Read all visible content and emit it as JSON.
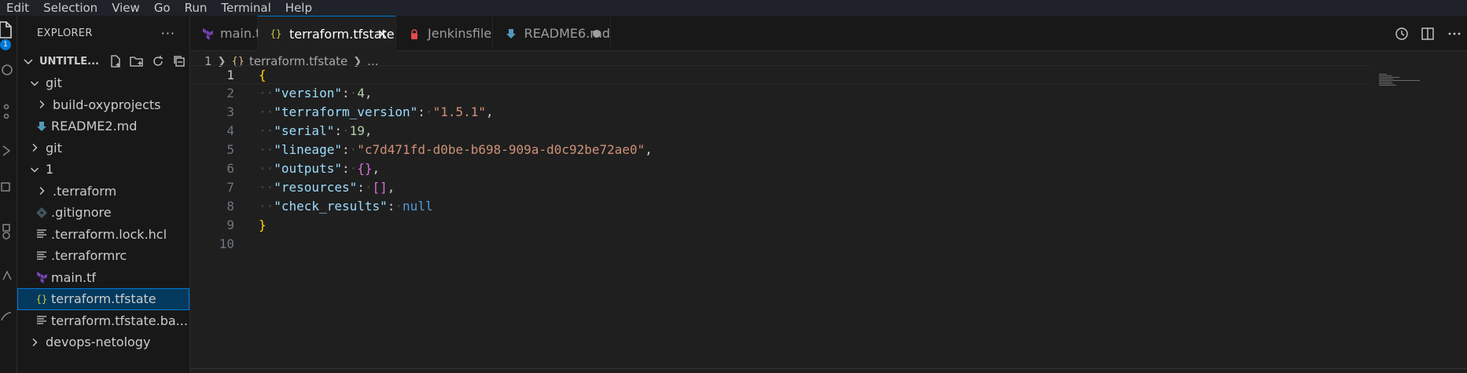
{
  "menu": [
    "Edit",
    "Selection",
    "View",
    "Go",
    "Run",
    "Terminal",
    "Help"
  ],
  "activity": {
    "scm_badge": "1"
  },
  "explorer": {
    "title": "EXPLORER",
    "more": "···",
    "folder": "UNTITLE...",
    "tree": [
      {
        "label": "git",
        "twisty": "down",
        "indent": 0,
        "icon": ""
      },
      {
        "label": "build-oxyprojects",
        "twisty": "right",
        "indent": 1,
        "icon": ""
      },
      {
        "label": "README2.md",
        "twisty": "",
        "indent": 1,
        "icon": "markdown-icon"
      },
      {
        "label": "git",
        "twisty": "right",
        "indent": 0,
        "icon": ""
      },
      {
        "label": "1",
        "twisty": "down",
        "indent": 0,
        "icon": ""
      },
      {
        "label": ".terraform",
        "twisty": "right",
        "indent": 1,
        "icon": ""
      },
      {
        "label": ".gitignore",
        "twisty": "",
        "indent": 1,
        "icon": "git-icon"
      },
      {
        "label": ".terraform.lock.hcl",
        "twisty": "",
        "indent": 1,
        "icon": "lines-icon"
      },
      {
        "label": ".terraformrc",
        "twisty": "",
        "indent": 1,
        "icon": "lines-icon"
      },
      {
        "label": "main.tf",
        "twisty": "",
        "indent": 1,
        "icon": "terraform-icon"
      },
      {
        "label": "terraform.tfstate",
        "twisty": "",
        "indent": 1,
        "icon": "json-icon",
        "selected": true
      },
      {
        "label": "terraform.tfstate.ba...",
        "twisty": "",
        "indent": 1,
        "icon": "lines-icon"
      },
      {
        "label": "devops-netology",
        "twisty": "right",
        "indent": 0,
        "icon": ""
      }
    ]
  },
  "tabs": [
    {
      "label": "main.tf",
      "icon": "terraform-icon"
    },
    {
      "label": "terraform.tfstate",
      "icon": "json-icon",
      "active": true,
      "close": "✕"
    },
    {
      "label": "Jenkinsfile",
      "icon": "jenkins-icon"
    },
    {
      "label": "README6.md",
      "icon": "markdown-icon",
      "dirty": true
    }
  ],
  "breadcrumb": {
    "folder": "1",
    "file": "terraform.tfstate",
    "icon": "{}",
    "more": "..."
  },
  "code": {
    "current_line": 1,
    "lines": [
      {
        "n": "1",
        "tokens": [
          [
            "brace",
            "{"
          ]
        ]
      },
      {
        "n": "2",
        "tokens": [
          [
            "dot",
            "··"
          ],
          [
            "key",
            "\"version\""
          ],
          [
            "punc",
            ":"
          ],
          [
            "dot",
            "·"
          ],
          [
            "num",
            "4"
          ],
          [
            "punc",
            ","
          ]
        ]
      },
      {
        "n": "3",
        "tokens": [
          [
            "dot",
            "··"
          ],
          [
            "key",
            "\"terraform_version\""
          ],
          [
            "punc",
            ":"
          ],
          [
            "dot",
            "·"
          ],
          [
            "str",
            "\"1.5.1\""
          ],
          [
            "punc",
            ","
          ]
        ]
      },
      {
        "n": "4",
        "tokens": [
          [
            "dot",
            "··"
          ],
          [
            "key",
            "\"serial\""
          ],
          [
            "punc",
            ":"
          ],
          [
            "dot",
            "·"
          ],
          [
            "num",
            "19"
          ],
          [
            "punc",
            ","
          ]
        ]
      },
      {
        "n": "5",
        "tokens": [
          [
            "dot",
            "··"
          ],
          [
            "key",
            "\"lineage\""
          ],
          [
            "punc",
            ":"
          ],
          [
            "dot",
            "·"
          ],
          [
            "str",
            "\"c7d471fd-d0be-b698-909a-d0c92be72ae0\""
          ],
          [
            "punc",
            ","
          ]
        ]
      },
      {
        "n": "6",
        "tokens": [
          [
            "dot",
            "··"
          ],
          [
            "key",
            "\"outputs\""
          ],
          [
            "punc",
            ":"
          ],
          [
            "dot",
            "·"
          ],
          [
            "bracket2",
            "{}"
          ],
          [
            "punc",
            ","
          ]
        ]
      },
      {
        "n": "7",
        "tokens": [
          [
            "dot",
            "··"
          ],
          [
            "key",
            "\"resources\""
          ],
          [
            "punc",
            ":"
          ],
          [
            "dot",
            "·"
          ],
          [
            "bracket2",
            "[]"
          ],
          [
            "punc",
            ","
          ]
        ]
      },
      {
        "n": "8",
        "tokens": [
          [
            "dot",
            "··"
          ],
          [
            "key",
            "\"check_results\""
          ],
          [
            "punc",
            ":"
          ],
          [
            "dot",
            "·"
          ],
          [
            "kw",
            "null"
          ]
        ]
      },
      {
        "n": "9",
        "tokens": [
          [
            "brace",
            "}"
          ]
        ]
      },
      {
        "n": "10",
        "tokens": []
      }
    ]
  },
  "colors": {
    "accent": "#0078d4",
    "selection": "#04395e"
  }
}
